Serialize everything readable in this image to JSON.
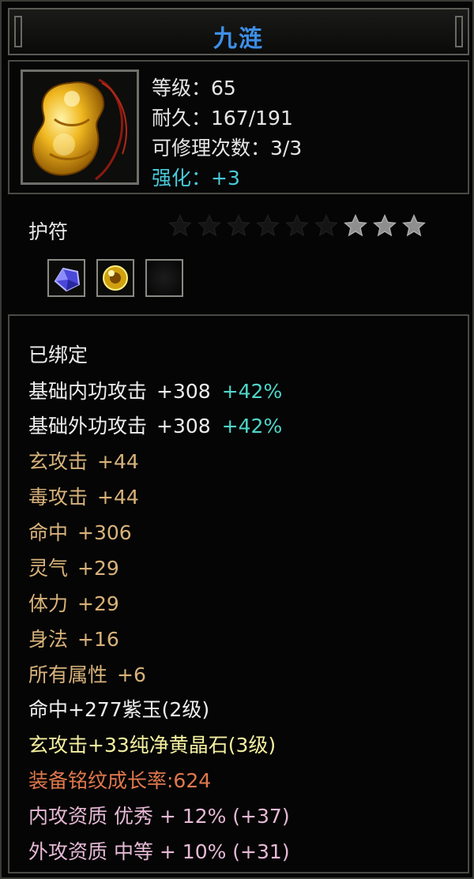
{
  "window": {
    "title": "九涟"
  },
  "item": {
    "stats": {
      "level": "等级：65",
      "durability": "耐久：167/191",
      "repairs": "可修理次数：3/3",
      "enhance": "强化：+3"
    },
    "category": "护符",
    "star_rating": {
      "filled": 3,
      "total": 9
    },
    "sockets": [
      {
        "icon": "purple-gem-icon"
      },
      {
        "icon": "yellow-gem-icon"
      },
      {
        "icon": "empty-socket-icon"
      }
    ]
  },
  "properties": {
    "bound": "已绑定",
    "inner_attack": {
      "label": "基础内功攻击",
      "value": "+308",
      "pct": "+42%"
    },
    "outer_attack": {
      "label": "基础外功攻击",
      "value": "+308",
      "pct": "+42%"
    },
    "xuan_attack": {
      "label": "玄攻击",
      "value": "+44"
    },
    "poison_attack": {
      "label": "毒攻击",
      "value": "+44"
    },
    "hit": {
      "label": "命中",
      "value": "+306"
    },
    "spirit": {
      "label": "灵气",
      "value": "+29"
    },
    "vitality": {
      "label": "体力",
      "value": "+29"
    },
    "agility": {
      "label": "身法",
      "value": "+16"
    },
    "all_attributes": {
      "label": "所有属性",
      "value": "+6"
    },
    "gem_line_1": "命中+277紫玉(2级)",
    "gem_line_2": "玄攻击+33纯净黄晶石(3级)",
    "growth_rate": "装备铭纹成长率:624",
    "inner_quality": "内攻资质 优秀 + 12% (+37)",
    "outer_quality": "外攻资质 中等 + 10% (+31)"
  },
  "colors": {
    "title": "#3d8fe6",
    "enhance": "#48c9d8",
    "percent": "#4fd6c9",
    "attribute": "#d8b27a",
    "gem": "#f4f0a0",
    "growth": "#e0784c",
    "quality": "#e6b9d6"
  }
}
